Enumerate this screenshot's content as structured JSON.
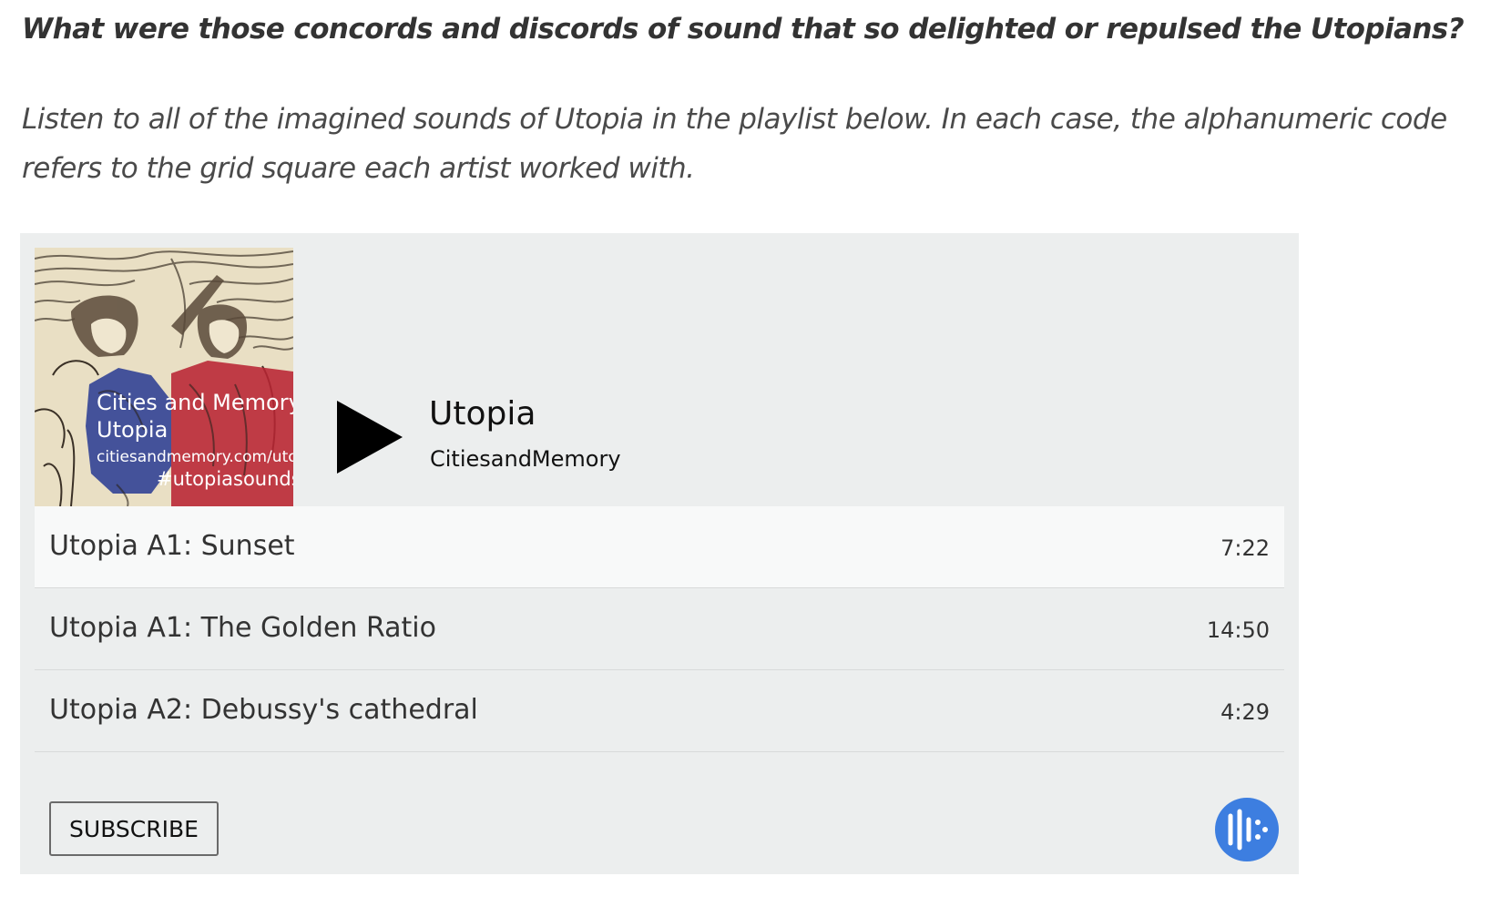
{
  "intro": {
    "heading": "What were those concords and discords of sound that so delighted or repulsed the Utopians?",
    "body": "Listen to all of the imagined sounds of Utopia in the playlist below. In each case, the alphanumeric code refers to the grid square each artist worked with."
  },
  "player": {
    "artwork": {
      "line1": "Cities and Memory",
      "line2": "Utopia",
      "line3": "citiesandmemory.com/utopia",
      "line4": "#utopiasounds"
    },
    "title": "Utopia",
    "artist": "CitiesandMemory",
    "tracks": [
      {
        "name": "Utopia A1: Sunset",
        "duration": "7:22"
      },
      {
        "name": "Utopia A1: The Golden Ratio",
        "duration": "14:50"
      },
      {
        "name": "Utopia A2: Debussy's cathedral",
        "duration": "4:29"
      }
    ],
    "subscribe_label": "SUBSCRIBE",
    "icons": {
      "play": "play-icon",
      "podcast": "podcast-app-icon"
    },
    "colors": {
      "player_background": "#eceeee",
      "active_row": "#f8f9f9",
      "podcast_badge": "#3d7ee0",
      "art_blue": "#2c3f94",
      "art_red": "#b82433"
    }
  }
}
